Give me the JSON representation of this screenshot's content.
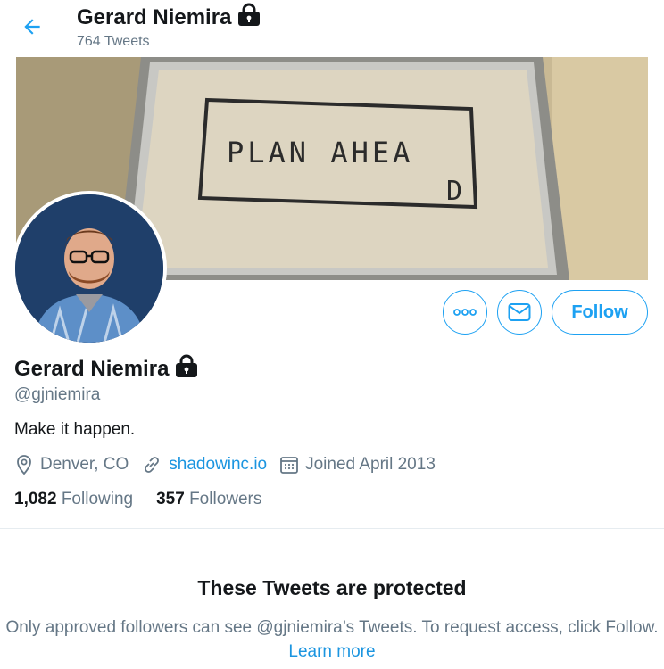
{
  "header": {
    "display_name": "Gerard Niemira",
    "tweet_count": "764 Tweets",
    "back_icon": "arrow-left-icon",
    "lock_icon": "lock-icon"
  },
  "banner": {
    "sign_text_line1": "PLAN AHEA",
    "sign_text_line2": "D"
  },
  "actions": {
    "more_icon": "more-dots-icon",
    "message_icon": "envelope-icon",
    "follow_label": "Follow"
  },
  "profile": {
    "display_name": "Gerard Niemira",
    "handle": "@gjniemira",
    "bio": "Make it happen.",
    "location": "Denver, CO",
    "website": "shadowinc.io",
    "joined": "Joined April 2013"
  },
  "stats": {
    "following_count": "1,082",
    "following_label": "Following",
    "followers_count": "357",
    "followers_label": "Followers"
  },
  "protected": {
    "title": "These Tweets are protected",
    "text_before": "Only approved followers can see @gjniemira’s Tweets. To request access, click Follow.",
    "learn_more": "Learn more"
  },
  "colors": {
    "accent": "#1da1f2",
    "link": "#1b95e0",
    "text_primary": "#14171a",
    "text_secondary": "#657786"
  }
}
